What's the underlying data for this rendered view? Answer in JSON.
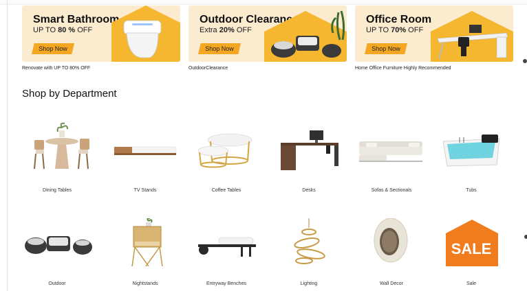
{
  "banners": [
    {
      "title": "Smart Bathroom",
      "sub_prefix": "UP TO ",
      "sub_bold": "80 %",
      "sub_suffix": " OFF",
      "button": "Shop Now",
      "caption": "Renovate with UP TO 80% OFF",
      "deco": "toilet-icon"
    },
    {
      "title": "Outdoor Clearance",
      "sub_prefix": "Extra ",
      "sub_bold": "20%",
      "sub_suffix": " OFF",
      "button": "Shop Now",
      "caption": "OutdoorClearance",
      "deco": "patio-furniture-icon"
    },
    {
      "title": "Office Room",
      "sub_prefix": "UP TO ",
      "sub_bold": "70%",
      "sub_suffix": " OFF",
      "button": "Shop Now",
      "caption": "Home Office Furniture Highly Recommended",
      "deco": "office-desk-icon"
    }
  ],
  "section": {
    "title": "Shop by Department"
  },
  "departments": [
    {
      "label": "Dining Tables"
    },
    {
      "label": "TV Stands"
    },
    {
      "label": "Coffee Tables"
    },
    {
      "label": "Desks"
    },
    {
      "label": "Sofas & Sectionals"
    },
    {
      "label": "Tubs"
    },
    {
      "label": "Outdoor"
    },
    {
      "label": "Nightstands"
    },
    {
      "label": "Entryway Benches"
    },
    {
      "label": "Lighting"
    },
    {
      "label": "Wall Decor"
    },
    {
      "label": "Sale",
      "badge": "SALE"
    }
  ],
  "colors": {
    "banner_bg": "#fbebcf",
    "accent": "#f5a623",
    "sale": "#f07c1e"
  }
}
